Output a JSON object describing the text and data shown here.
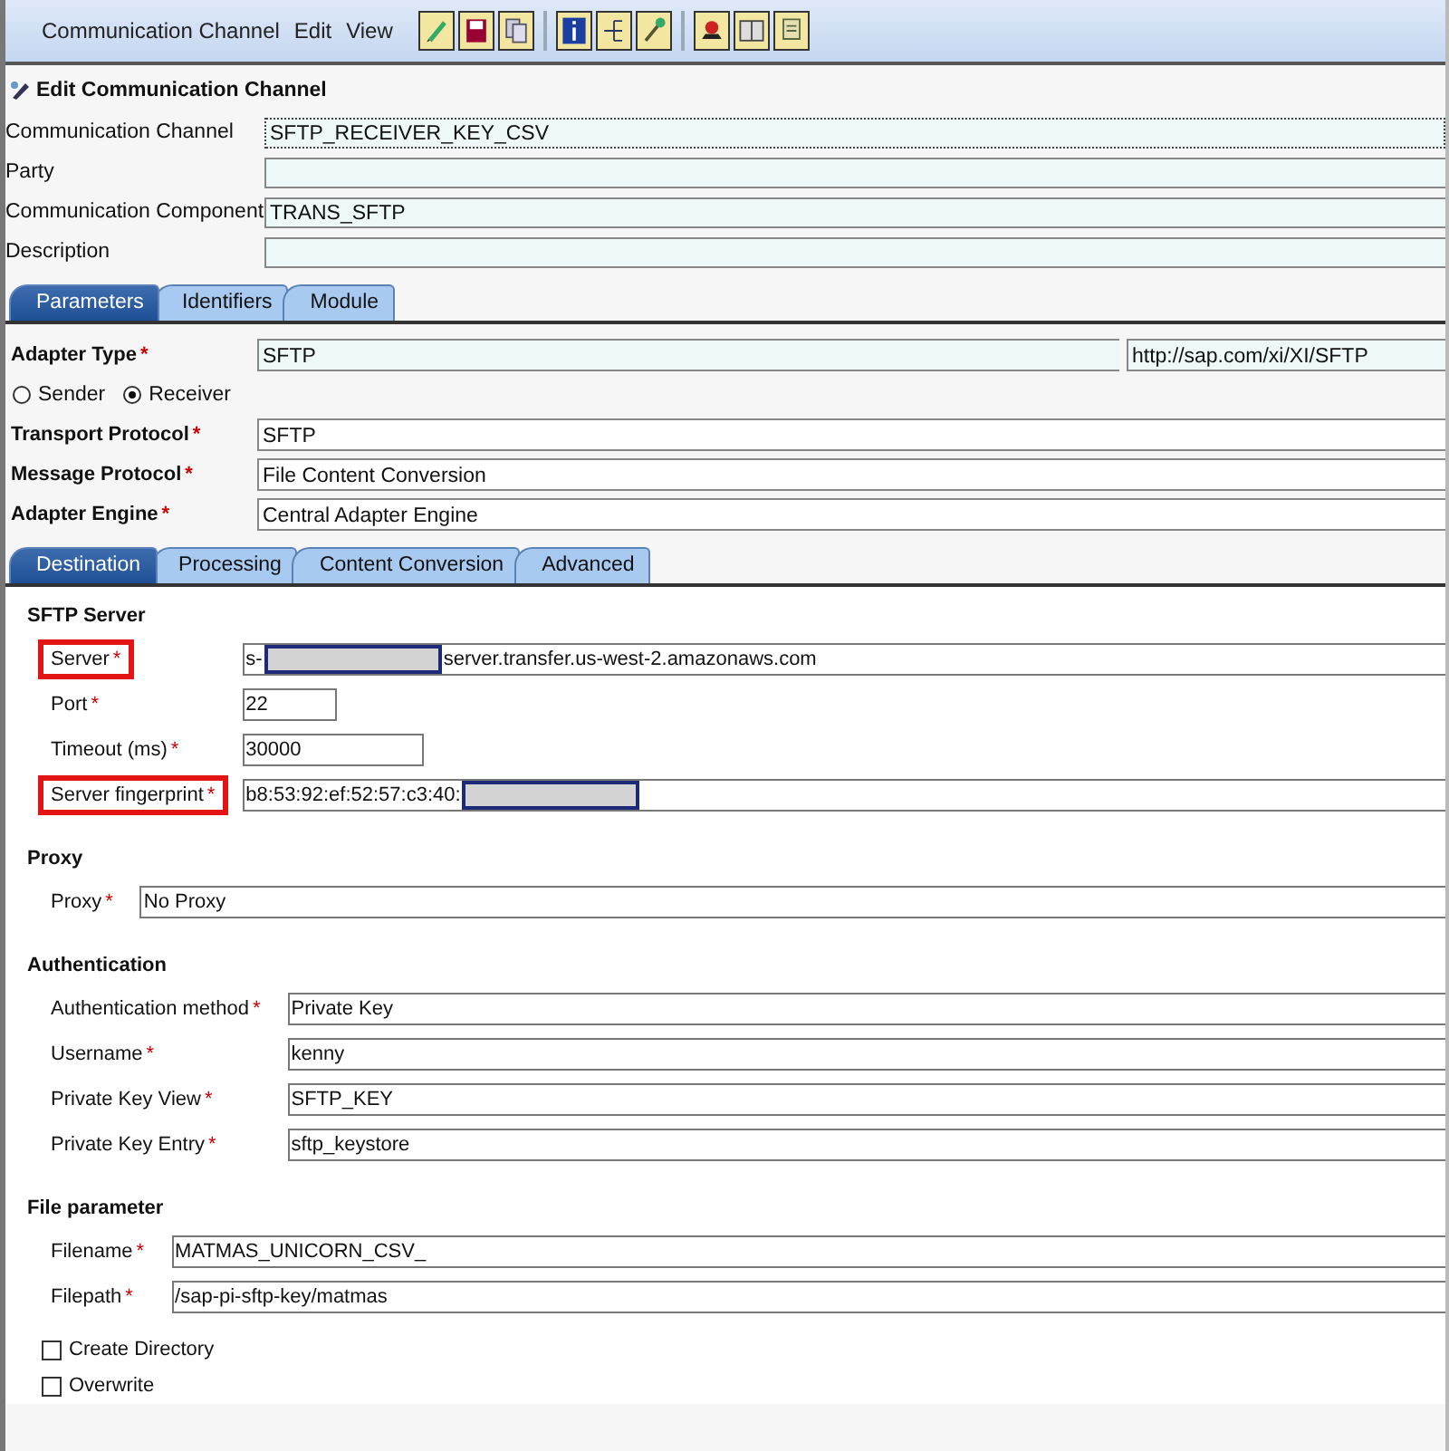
{
  "menu": {
    "items": [
      "Communication Channel",
      "Edit",
      "View"
    ]
  },
  "header": {
    "title": "Edit Communication Channel",
    "fields": [
      {
        "label": "Communication Channel",
        "value": "SFTP_RECEIVER_KEY_CSV"
      },
      {
        "label": "Party"
      },
      {
        "label": "Communication Component",
        "value": "TRANS_SFTP"
      },
      {
        "label": "Description"
      }
    ]
  },
  "main_tabs": [
    {
      "label": "Parameters",
      "selected": true
    },
    {
      "label": "Identifiers",
      "selected": false
    },
    {
      "label": "Module",
      "selected": false
    }
  ],
  "parameters": {
    "adapter_type": {
      "label": "Adapter Type",
      "asterisk": "*",
      "value": "SFTP",
      "namespace": "http://sap.com/xi/XI/SFTP"
    },
    "directions": [
      {
        "label": "Sender",
        "selected": false
      },
      {
        "label": "Receiver",
        "selected": true
      }
    ],
    "fields": [
      {
        "label": "Transport Protocol",
        "asterisk": "*",
        "value": "SFTP"
      },
      {
        "label": "Message Protocol",
        "asterisk": "*",
        "value": "File Content Conversion"
      },
      {
        "label": "Adapter Engine",
        "asterisk": "*",
        "value": "Central Adapter Engine"
      }
    ]
  },
  "sub_tabs": [
    {
      "label": "Destination",
      "selected": true
    },
    {
      "label": "Processing",
      "selected": false
    },
    {
      "label": "Content Conversion",
      "selected": false
    },
    {
      "label": "Advanced",
      "selected": false
    }
  ],
  "sections": [
    {
      "title": "SFTP Server",
      "fields": [
        {
          "label": "Server",
          "asterisk": "*",
          "highlighted": true,
          "kind": "wide",
          "segments": [
            {
              "kind": "text",
              "text": "s-"
            },
            {
              "kind": "redacted"
            },
            {
              "kind": "text",
              "text": "server.transfer.us-west-2.amazonaws.com"
            }
          ]
        },
        {
          "label": "Port",
          "asterisk": "*",
          "highlighted": false,
          "kind": "short",
          "segments": [
            {
              "kind": "text",
              "text": "22"
            }
          ]
        },
        {
          "label": "Timeout (ms)",
          "asterisk": "*",
          "highlighted": false,
          "kind": "medium",
          "segments": [
            {
              "kind": "text",
              "text": "30000"
            }
          ]
        },
        {
          "label": "Server fingerprint",
          "asterisk": "*",
          "highlighted": true,
          "kind": "wide",
          "segments": [
            {
              "kind": "text",
              "text": "b8:53:92:ef:52:57:c3:40:"
            },
            {
              "kind": "redacted"
            }
          ]
        }
      ]
    },
    {
      "title": "Proxy",
      "fields": [
        {
          "label": "Proxy",
          "asterisk": "*",
          "highlighted": false,
          "kind": "wide",
          "segments": [
            {
              "kind": "text",
              "text": "No Proxy"
            }
          ]
        }
      ]
    },
    {
      "title": "Authentication",
      "fields": [
        {
          "label": "Authentication method",
          "asterisk": "*",
          "highlighted": false,
          "kind": "wide",
          "segments": [
            {
              "kind": "text",
              "text": "Private Key"
            }
          ]
        },
        {
          "label": "Username",
          "asterisk": "*",
          "highlighted": false,
          "kind": "wide",
          "segments": [
            {
              "kind": "text",
              "text": "kenny"
            }
          ]
        },
        {
          "label": "Private Key View",
          "asterisk": "*",
          "highlighted": false,
          "kind": "wide",
          "segments": [
            {
              "kind": "text",
              "text": "SFTP_KEY"
            }
          ]
        },
        {
          "label": "Private Key Entry",
          "asterisk": "*",
          "highlighted": false,
          "kind": "wide",
          "segments": [
            {
              "kind": "text",
              "text": "sftp_keystore"
            }
          ]
        }
      ]
    },
    {
      "title": "File parameter",
      "fields": [
        {
          "label": "Filename",
          "asterisk": "*",
          "highlighted": false,
          "kind": "wide",
          "segments": [
            {
              "kind": "text",
              "text": "MATMAS_UNICORN_CSV_"
            }
          ]
        },
        {
          "label": "Filepath",
          "asterisk": "*",
          "highlighted": false,
          "kind": "wide",
          "segments": [
            {
              "kind": "text",
              "text": "/sap-pi-sftp-key/matmas"
            }
          ]
        }
      ],
      "checkboxes": [
        {
          "label": "Create Directory",
          "checked": false
        },
        {
          "label": "Overwrite",
          "checked": false
        }
      ]
    }
  ]
}
